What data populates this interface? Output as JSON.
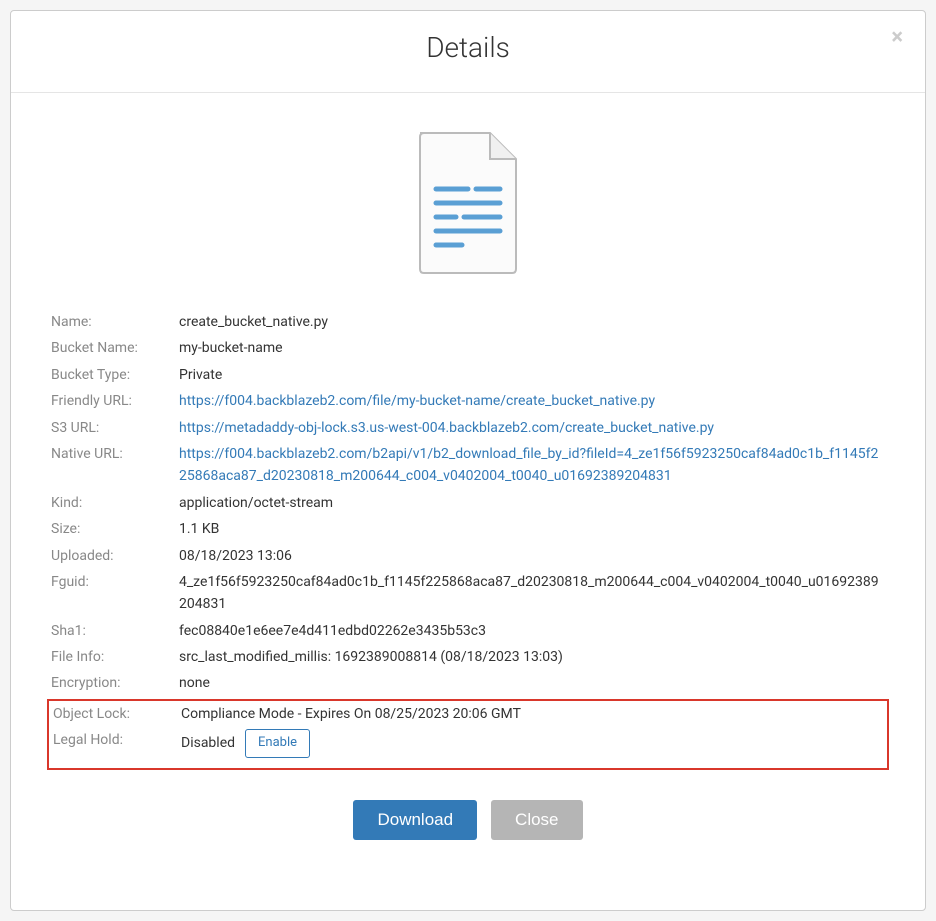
{
  "modal": {
    "title": "Details",
    "close_symbol": "×"
  },
  "fields": {
    "name": {
      "label": "Name:",
      "value": "create_bucket_native.py"
    },
    "bucket_name": {
      "label": "Bucket Name:",
      "value": "my-bucket-name"
    },
    "bucket_type": {
      "label": "Bucket Type:",
      "value": "Private"
    },
    "friendly_url": {
      "label": "Friendly URL:",
      "value": "https://f004.backblazeb2.com/file/my-bucket-name/create_bucket_native.py"
    },
    "s3_url": {
      "label": "S3 URL:",
      "value": "https://metadaddy-obj-lock.s3.us-west-004.backblazeb2.com/create_bucket_native.py"
    },
    "native_url": {
      "label": "Native URL:",
      "value": "https://f004.backblazeb2.com/b2api/v1/b2_download_file_by_id?fileId=4_ze1f56f5923250caf84ad0c1b_f1145f225868aca87_d20230818_m200644_c004_v0402004_t0040_u01692389204831"
    },
    "kind": {
      "label": "Kind:",
      "value": "application/octet-stream"
    },
    "size": {
      "label": "Size:",
      "value": "1.1 KB"
    },
    "uploaded": {
      "label": "Uploaded:",
      "value": "08/18/2023 13:06"
    },
    "fguid": {
      "label": "Fguid:",
      "value": "4_ze1f56f5923250caf84ad0c1b_f1145f225868aca87_d20230818_m200644_c004_v0402004_t0040_u01692389204831"
    },
    "sha1": {
      "label": "Sha1:",
      "value": "fec08840e1e6ee7e4d411edbd02262e3435b53c3"
    },
    "file_info": {
      "label": "File Info:",
      "value": "src_last_modified_millis: 1692389008814   (08/18/2023 13:03)"
    },
    "encryption": {
      "label": "Encryption:",
      "value": "none"
    },
    "object_lock": {
      "label": "Object Lock:",
      "value": "Compliance Mode - Expires On 08/25/2023 20:06 GMT"
    },
    "legal_hold": {
      "label": "Legal Hold:",
      "status": "Disabled",
      "button": "Enable"
    }
  },
  "buttons": {
    "download": "Download",
    "close": "Close"
  }
}
